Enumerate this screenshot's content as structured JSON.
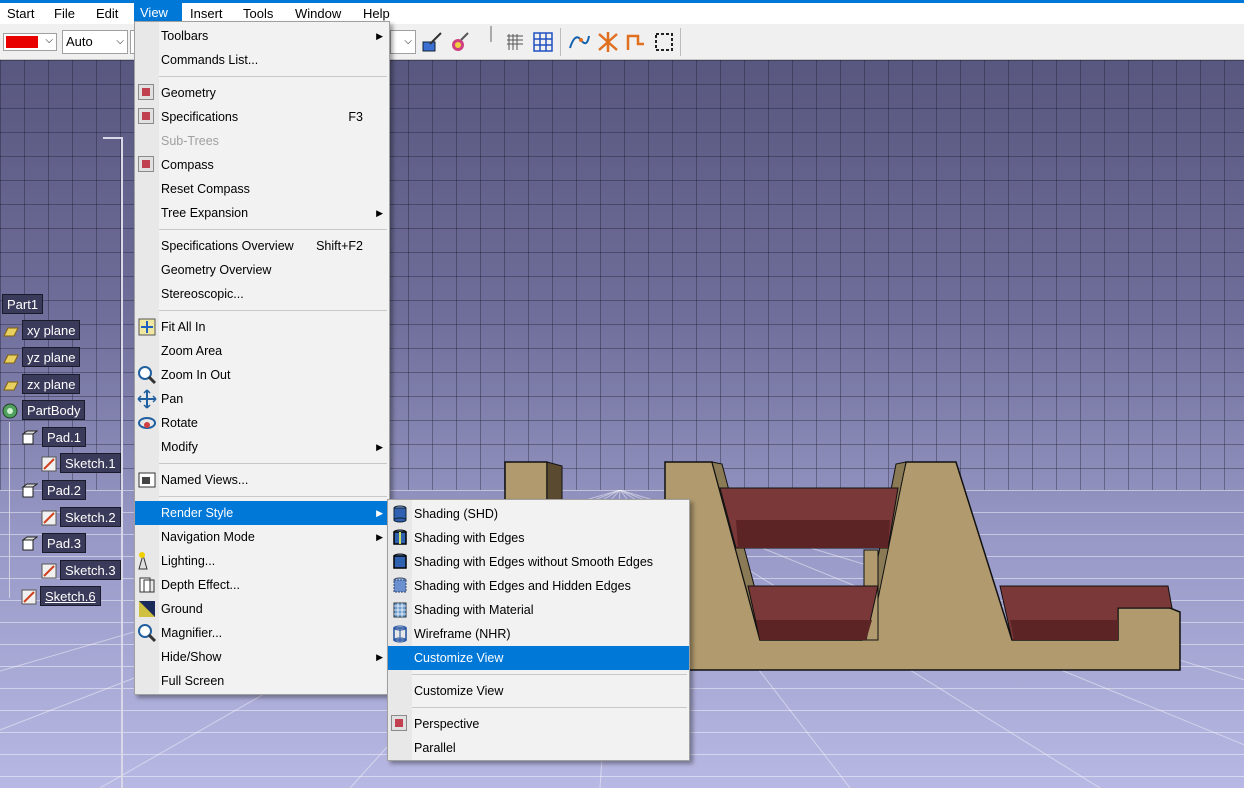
{
  "menubar": {
    "items": [
      {
        "label": "Start"
      },
      {
        "label": "File"
      },
      {
        "label": "Edit"
      },
      {
        "label": "View"
      },
      {
        "label": "Insert"
      },
      {
        "label": "Tools"
      },
      {
        "label": "Window"
      },
      {
        "label": "Help"
      }
    ],
    "active": "View"
  },
  "toolbar": {
    "color_value": "#e80000",
    "linetype_value": "Auto"
  },
  "tree": {
    "root": "Part1",
    "items": [
      {
        "label": "xy plane",
        "icon": "plane-icon"
      },
      {
        "label": "yz plane",
        "icon": "plane-icon"
      },
      {
        "label": "zx plane",
        "icon": "plane-icon"
      },
      {
        "label": "PartBody",
        "icon": "partbody-icon"
      },
      {
        "label": "Pad.1",
        "icon": "pad-icon"
      },
      {
        "label": "Sketch.1",
        "icon": "sketch-icon"
      },
      {
        "label": "Pad.2",
        "icon": "pad-icon"
      },
      {
        "label": "Sketch.2",
        "icon": "sketch-icon"
      },
      {
        "label": "Pad.3",
        "icon": "pad-icon"
      },
      {
        "label": "Sketch.3",
        "icon": "sketch-icon"
      },
      {
        "label": "Sketch.6",
        "icon": "sketch-icon"
      }
    ]
  },
  "view_menu": {
    "items": [
      {
        "label": "Toolbars",
        "submenu": true
      },
      {
        "label": "Commands List..."
      },
      {
        "label": "Geometry",
        "checked": true
      },
      {
        "label": "Specifications",
        "shortcut": "F3",
        "checked": true
      },
      {
        "label": "Sub-Trees",
        "disabled": true
      },
      {
        "label": "Compass",
        "checked": true
      },
      {
        "label": "Reset Compass"
      },
      {
        "label": "Tree Expansion",
        "submenu": true
      },
      {
        "label": "Specifications Overview",
        "shortcut": "Shift+F2"
      },
      {
        "label": "Geometry Overview"
      },
      {
        "label": "Stereoscopic..."
      },
      {
        "label": "Fit All In",
        "icon": "fit-all-in-icon"
      },
      {
        "label": "Zoom Area"
      },
      {
        "label": "Zoom In Out",
        "icon": "zoom-icon"
      },
      {
        "label": "Pan",
        "icon": "pan-icon"
      },
      {
        "label": "Rotate",
        "icon": "rotate-icon"
      },
      {
        "label": "Modify",
        "submenu": true
      },
      {
        "label": "Named Views...",
        "icon": "named-views-icon"
      },
      {
        "label": "Render Style",
        "submenu": true,
        "highlighted": true
      },
      {
        "label": "Navigation Mode",
        "submenu": true
      },
      {
        "label": "Lighting...",
        "icon": "lighting-icon"
      },
      {
        "label": "Depth Effect...",
        "icon": "depth-effect-icon"
      },
      {
        "label": "Ground",
        "icon": "ground-icon"
      },
      {
        "label": "Magnifier...",
        "icon": "magnifier-icon"
      },
      {
        "label": "Hide/Show",
        "submenu": true
      },
      {
        "label": "Full Screen"
      }
    ]
  },
  "render_menu": {
    "items": [
      {
        "label": "Shading (SHD)",
        "icon": "shading-icon"
      },
      {
        "label": "Shading with Edges",
        "icon": "shading-edges-icon"
      },
      {
        "label": "Shading with Edges without Smooth Edges",
        "icon": "shading-no-smooth-icon"
      },
      {
        "label": "Shading with Edges and Hidden Edges",
        "icon": "shading-hidden-icon"
      },
      {
        "label": "Shading with Material",
        "icon": "shading-material-icon"
      },
      {
        "label": "Wireframe (NHR)",
        "icon": "wireframe-icon"
      },
      {
        "label": "Customize View",
        "highlighted": true
      },
      {
        "label": "Customize View"
      },
      {
        "label": "Perspective",
        "checked": true
      },
      {
        "label": "Parallel"
      }
    ]
  }
}
